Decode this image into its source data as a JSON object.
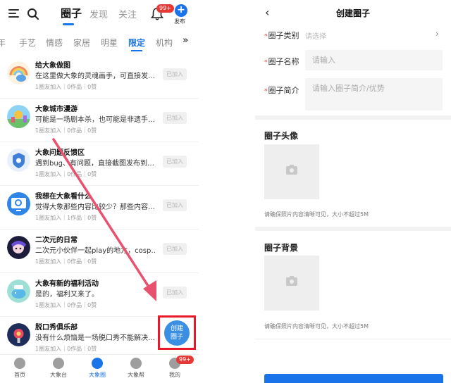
{
  "left": {
    "main_tabs": [
      {
        "label": "圈子"
      },
      {
        "label": "发现"
      },
      {
        "label": "关注"
      }
    ],
    "bell_badge": "99+",
    "publish_label": "发布",
    "categories": [
      "年",
      "手艺",
      "情感",
      "家居",
      "明星",
      "限定",
      "机构"
    ],
    "more_symbol": "»",
    "join_label": "已加入",
    "items": [
      {
        "title": "给大象做图",
        "desc": "在这里做大象的灵魂画手，可直接发…",
        "meta": "1圈友加入｜0作品｜0赞"
      },
      {
        "title": "大象城市漫游",
        "desc": "可能是一场剧本杀，也可能是非遗手…",
        "meta": "1圈友加入｜0作品｜0赞"
      },
      {
        "title": "大象问题反馈区",
        "desc": "遇到bug、有问题，直接截图发布到…",
        "meta": "1圈友加入｜0作品｜0赞"
      },
      {
        "title": "我想在大象看什么",
        "desc": "觉得大象那些内容比较少？那些内容…",
        "meta": "1圈友加入｜1作品｜0赞"
      },
      {
        "title": "二次元的日常",
        "desc": "二次元小伙伴一起play的地方，cosp…",
        "meta": "1圈友加入｜0作品｜0赞"
      },
      {
        "title": "大象有新的福利活动",
        "desc": "是的，福利又来了。",
        "meta": "1圈友加入｜0作品｜0赞"
      },
      {
        "title": "脱口秀俱乐部",
        "desc": "没有什么烦恼是一场脱口秀不能解决…",
        "meta": "1圈友加入｜0作品｜0赞"
      }
    ],
    "create_button": {
      "line1": "创建",
      "line2": "圈子"
    },
    "bottom_nav": [
      {
        "label": "首页"
      },
      {
        "label": "大象台"
      },
      {
        "label": "大象圈"
      },
      {
        "label": "大象帮"
      },
      {
        "label": "我的"
      }
    ],
    "me_badge": "99+"
  },
  "right": {
    "back_symbol": "‹",
    "title": "创建圈子",
    "category_label": "圈子类别",
    "category_placeholder": "请选择",
    "chevron": "›",
    "name_label": "圈子名称",
    "name_placeholder": "请输入",
    "intro_label": "圈子简介",
    "intro_placeholder": "请输入圈子简介/优势",
    "required_mark": "*",
    "avatar_title": "圈子头像",
    "avatar_hint": "请确保照片内容清晰可见，大小不超过5M",
    "background_title": "圈子背景",
    "background_hint": "请确保照片内容清晰可见，大小不超过5M"
  },
  "colors": {
    "accent": "#1a73e8",
    "annotation_red": "#e8182a",
    "arrow_pink": "#e8526e"
  }
}
